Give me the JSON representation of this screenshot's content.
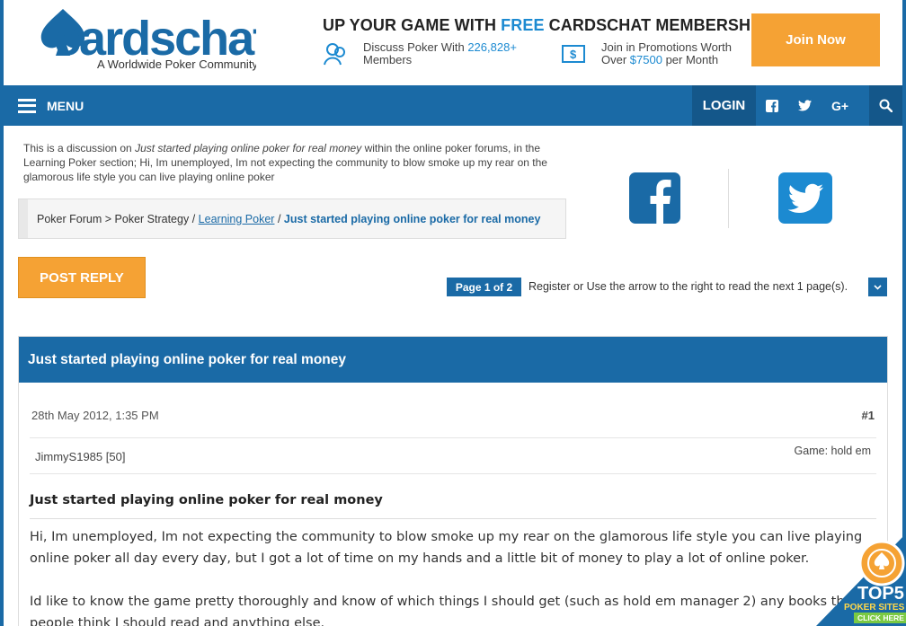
{
  "brand": {
    "name": "cardschat",
    "tagline": "A Worldwide Poker Community"
  },
  "promo": {
    "title_pre": "UP YOUR GAME WITH",
    "title_free": "FREE",
    "title_post": "CARDSCHAT MEMBERSHIP",
    "item1_pre": "Discuss Poker With",
    "item1_count": "226,828+",
    "item1_post": "Members",
    "item2_pre": "Join in Promotions Worth",
    "item2_over": "Over",
    "item2_amount": "$7500",
    "item2_post": "per Month",
    "join_label": "Join Now"
  },
  "nav": {
    "menu_label": "MENU",
    "login_label": "LOGIN",
    "icons": [
      "facebook-icon",
      "twitter-icon",
      "google-plus-icon",
      "search-icon"
    ]
  },
  "intro": {
    "pre": "This is a discussion on",
    "thread_title": "Just started playing online poker for real money",
    "post": "within the online poker forums, in the Learning Poker section; Hi, Im unemployed, Im not expecting the community to blow smoke up my rear on the glamorous life style you can live playing online poker"
  },
  "breadcrumb": {
    "forum": "Poker Forum",
    "sep1": ">",
    "strategy": "Poker Strategy",
    "sep2": "/",
    "section": "Learning Poker",
    "sep3": "/",
    "current": "Just started playing online poker for real money"
  },
  "actions": {
    "post_reply": "POST REPLY",
    "page_badge": "Page 1 of 2",
    "page_text": "Register or Use the arrow to the right to read the next 1 page(s)."
  },
  "thread": {
    "header_title": "Just started playing online poker for real money",
    "post": {
      "date": "28th May 2012, 1:35 PM",
      "number": "#1",
      "user": "JimmyS1985 [50]",
      "game": "Game: hold em",
      "title": "Just started playing online poker for real money",
      "body_p1": "Hi, Im unemployed, Im not expecting the community to blow smoke up my rear on the glamorous life style you can live playing online poker all day every day, but I got a lot of time on my hands and a little bit of money to play a lot of online poker.",
      "body_p2": "Id like to know the game pretty thoroughly and know of which things I should get (such as hold em manager 2) any books that people think I should read and anything else."
    }
  },
  "badge": {
    "top5": "TOP5",
    "sites": "POKER SITES",
    "click": "CLICK HERE"
  },
  "colors": {
    "primary": "#1a6aa6",
    "accent": "#f5a234",
    "link": "#1c8ad1"
  }
}
